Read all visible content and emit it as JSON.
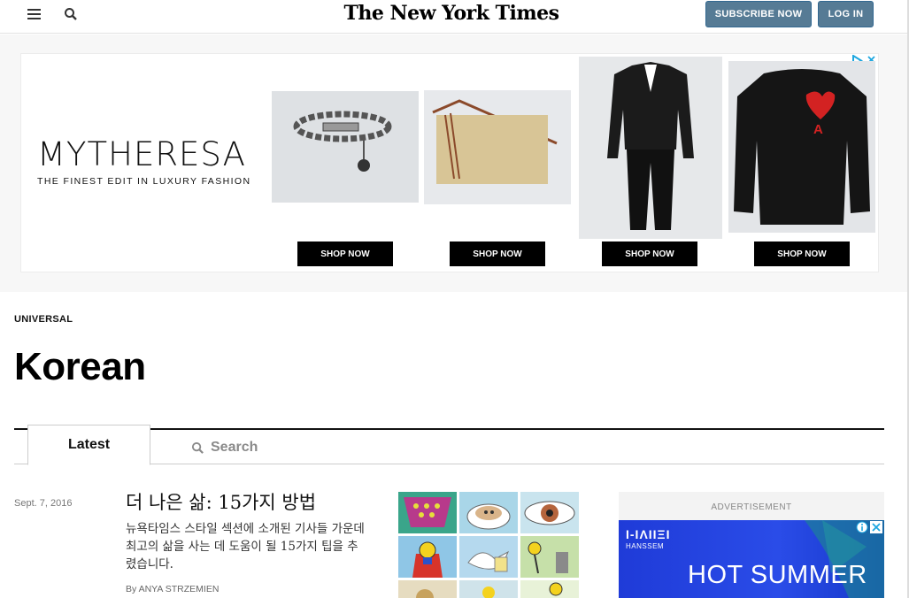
{
  "header": {
    "logo": "The New York Times",
    "subscribe_label": "SUBSCRIBE NOW",
    "login_label": "LOG IN"
  },
  "ad_banner": {
    "brand": "MYTHERESA",
    "tagline": "THE FINEST EDIT IN LUXURY FASHION",
    "products": [
      {
        "name": "bracelet",
        "cta": "SHOP NOW"
      },
      {
        "name": "bag",
        "cta": "SHOP NOW"
      },
      {
        "name": "suit",
        "cta": "SHOP NOW"
      },
      {
        "name": "sweater",
        "cta": "SHOP NOW"
      }
    ]
  },
  "section": {
    "kicker": "UNIVERSAL",
    "title": "Korean"
  },
  "tabs": {
    "latest": "Latest",
    "search": "Search"
  },
  "article": {
    "date": "Sept. 7, 2016",
    "headline": "더 나은 삶: 15가지 방법",
    "summary": "뉴욕타임스 스타일 섹션에 소개된 기사들 가운데 최고의 삶을 사는 데 도움이 될 15가지 팁을 추렸습니다.",
    "byline": "By ANYA STRZEMIEN"
  },
  "side_ad": {
    "label": "ADVERTISEMENT",
    "brand": "HANSSEM",
    "headline": "HOT SUMMER"
  },
  "colors": {
    "button_bg": "#567b95",
    "ad_blue": "#2a4ce8"
  }
}
